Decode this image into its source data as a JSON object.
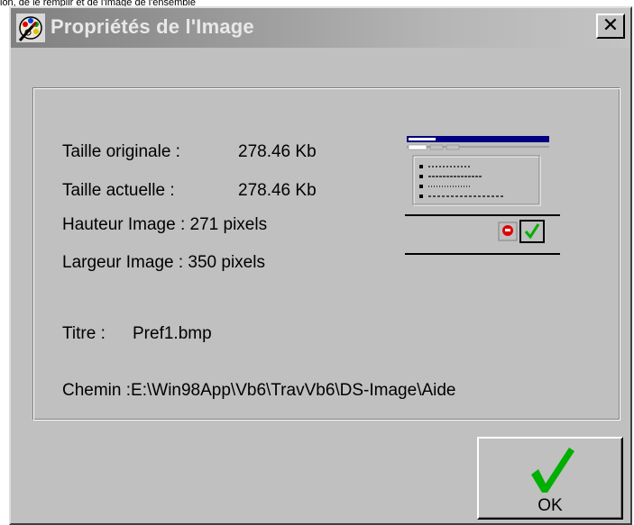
{
  "window": {
    "title": "Propriétés de l'Image",
    "close_symbol": "✕",
    "caption_fragment": "ion, de le remplir et de l'image de l'ensemble"
  },
  "info": {
    "original_size_label": "Taille originale :",
    "original_size_value": "278.46 Kb",
    "current_size_label": "Taille actuelle :",
    "current_size_value": "278.46 Kb",
    "height_text": "Hauteur Image : 271 pixels",
    "width_text": "Largeur Image : 350 pixels",
    "title_label": "Titre :",
    "title_value": "Pref1.bmp",
    "path_text": "Chemin :E:\\Win98App\\Vb6\\TravVb6\\DS-Image\\Aide"
  },
  "ok_button": {
    "label": "OK"
  },
  "icons": {
    "app": "palette-icon",
    "close": "close-icon",
    "ok": "checkmark-icon"
  },
  "colors": {
    "dialog_face": "#c0c0c0",
    "check_green": "#00b000",
    "titlebar_start": "#808080",
    "titlebar_end": "#c4c4c4"
  }
}
